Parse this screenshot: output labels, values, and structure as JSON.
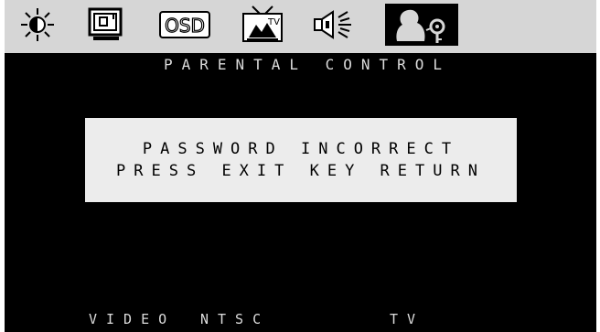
{
  "menu": {
    "tabs": [
      {
        "name": "brightness",
        "icon": "sun-icon",
        "active": false
      },
      {
        "name": "picture",
        "icon": "monitor-icon",
        "active": false
      },
      {
        "name": "osd",
        "icon": "osd-icon",
        "icon_text": "OSD",
        "active": false
      },
      {
        "name": "tv",
        "icon": "tv-antenna-icon",
        "icon_text": "TV",
        "active": false
      },
      {
        "name": "sound",
        "icon": "speaker-icon",
        "active": false
      },
      {
        "name": "parental",
        "icon": "parental-lock-icon",
        "active": true
      }
    ]
  },
  "section_title": "PARENTAL CONTROL",
  "message": {
    "line1": "PASSWORD INCORRECT",
    "line2": "PRESS EXIT KEY RETURN"
  },
  "status": {
    "input": "VIDEO",
    "standard": "NTSC",
    "source": "TV"
  },
  "colors": {
    "background": "#000000",
    "menubar": "#d6d6d6",
    "message_box": "#ececec",
    "text": "#dcdcdc"
  }
}
